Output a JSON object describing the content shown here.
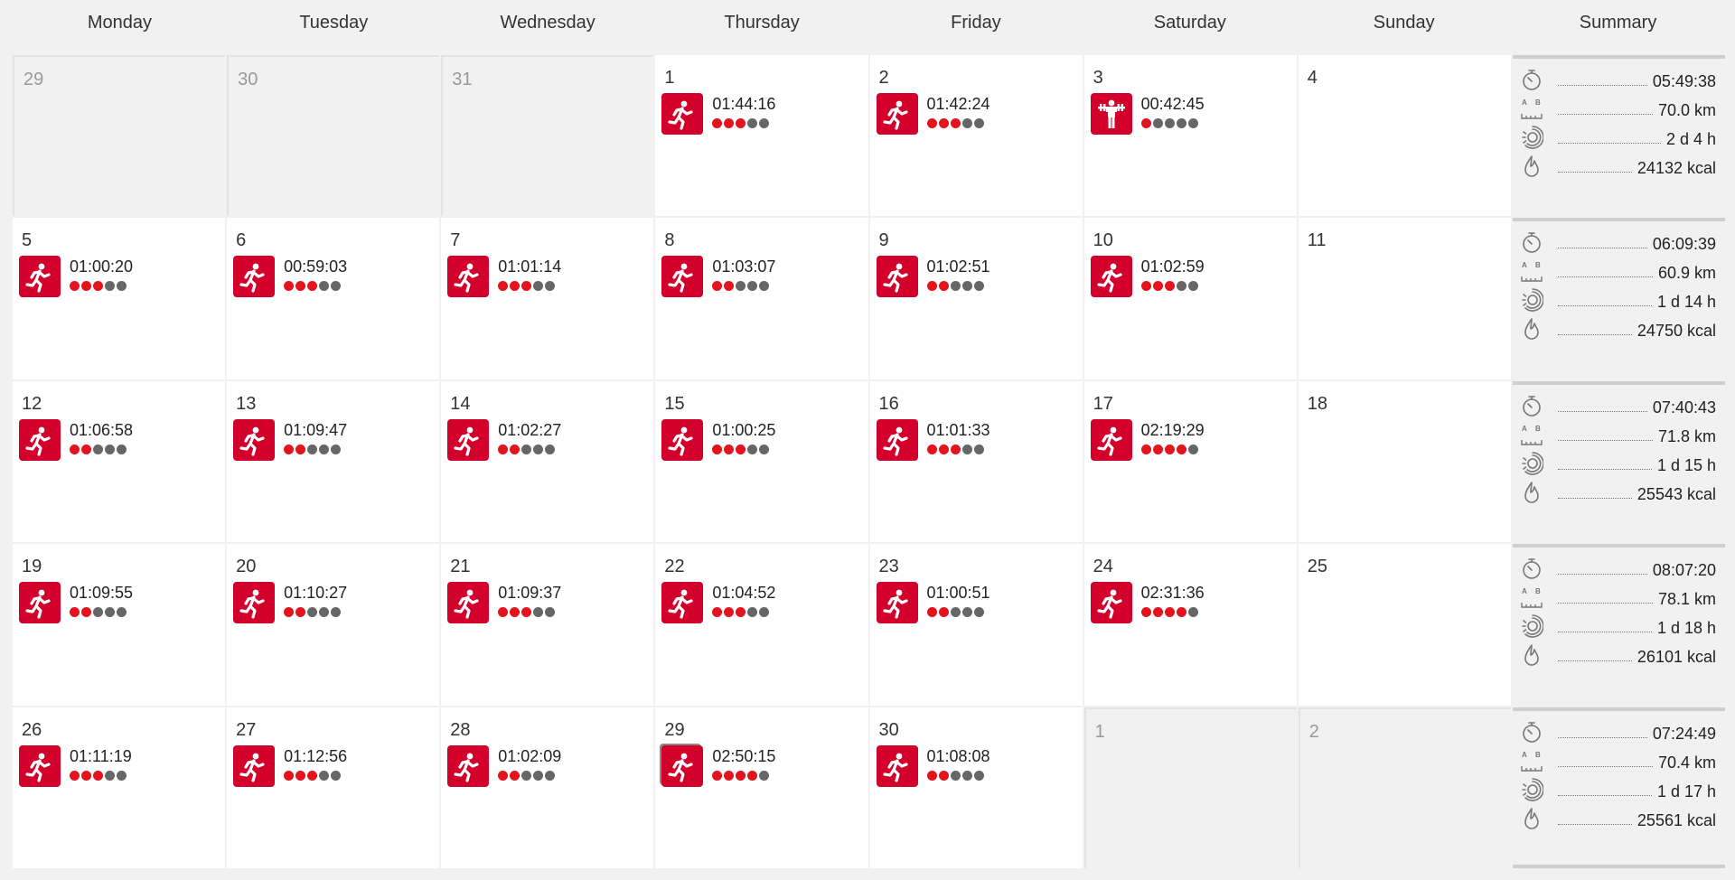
{
  "header": {
    "columns": [
      "Monday",
      "Tuesday",
      "Wednesday",
      "Thursday",
      "Friday",
      "Saturday",
      "Sunday",
      "Summary"
    ]
  },
  "colors": {
    "accent": "#d2002a",
    "dot_on": "#e3141e",
    "dot_off": "#666666"
  },
  "weeks": [
    {
      "days": [
        {
          "day": "29",
          "other_month": true
        },
        {
          "day": "30",
          "other_month": true
        },
        {
          "day": "31",
          "other_month": true
        },
        {
          "day": "1",
          "workout": {
            "sport": "running-icon",
            "duration": "01:44:16",
            "intensity": 3
          }
        },
        {
          "day": "2",
          "workout": {
            "sport": "running-icon",
            "duration": "01:42:24",
            "intensity": 3
          }
        },
        {
          "day": "3",
          "workout": {
            "sport": "strength-training-icon",
            "duration": "00:42:45",
            "intensity": 1
          }
        },
        {
          "day": "4"
        }
      ],
      "summary": {
        "duration": "05:49:38",
        "distance": "70.0 km",
        "recovery": "2 d 4 h",
        "calories": "24132 kcal"
      }
    },
    {
      "days": [
        {
          "day": "5",
          "workout": {
            "sport": "running-icon",
            "duration": "01:00:20",
            "intensity": 3
          }
        },
        {
          "day": "6",
          "workout": {
            "sport": "running-icon",
            "duration": "00:59:03",
            "intensity": 3
          }
        },
        {
          "day": "7",
          "workout": {
            "sport": "running-icon",
            "duration": "01:01:14",
            "intensity": 3
          }
        },
        {
          "day": "8",
          "workout": {
            "sport": "running-icon",
            "duration": "01:03:07",
            "intensity": 2
          }
        },
        {
          "day": "9",
          "workout": {
            "sport": "running-icon",
            "duration": "01:02:51",
            "intensity": 2
          }
        },
        {
          "day": "10",
          "workout": {
            "sport": "running-icon",
            "duration": "01:02:59",
            "intensity": 3
          }
        },
        {
          "day": "11"
        }
      ],
      "summary": {
        "duration": "06:09:39",
        "distance": "60.9 km",
        "recovery": "1 d 14 h",
        "calories": "24750 kcal"
      }
    },
    {
      "days": [
        {
          "day": "12",
          "workout": {
            "sport": "running-icon",
            "duration": "01:06:58",
            "intensity": 2
          }
        },
        {
          "day": "13",
          "workout": {
            "sport": "running-icon",
            "duration": "01:09:47",
            "intensity": 2
          }
        },
        {
          "day": "14",
          "workout": {
            "sport": "running-icon",
            "duration": "01:02:27",
            "intensity": 2
          }
        },
        {
          "day": "15",
          "workout": {
            "sport": "running-icon",
            "duration": "01:00:25",
            "intensity": 3
          }
        },
        {
          "day": "16",
          "workout": {
            "sport": "running-icon",
            "duration": "01:01:33",
            "intensity": 3
          }
        },
        {
          "day": "17",
          "workout": {
            "sport": "running-icon",
            "duration": "02:19:29",
            "intensity": 4
          }
        },
        {
          "day": "18"
        }
      ],
      "summary": {
        "duration": "07:40:43",
        "distance": "71.8 km",
        "recovery": "1 d 15 h",
        "calories": "25543 kcal"
      }
    },
    {
      "days": [
        {
          "day": "19",
          "workout": {
            "sport": "running-icon",
            "duration": "01:09:55",
            "intensity": 2
          }
        },
        {
          "day": "20",
          "workout": {
            "sport": "running-icon",
            "duration": "01:10:27",
            "intensity": 2
          }
        },
        {
          "day": "21",
          "workout": {
            "sport": "running-icon",
            "duration": "01:09:37",
            "intensity": 3
          }
        },
        {
          "day": "22",
          "workout": {
            "sport": "running-icon",
            "duration": "01:04:52",
            "intensity": 3
          }
        },
        {
          "day": "23",
          "workout": {
            "sport": "running-icon",
            "duration": "01:00:51",
            "intensity": 2
          }
        },
        {
          "day": "24",
          "workout": {
            "sport": "running-icon",
            "duration": "02:31:36",
            "intensity": 4
          }
        },
        {
          "day": "25"
        }
      ],
      "summary": {
        "duration": "08:07:20",
        "distance": "78.1 km",
        "recovery": "1 d 18 h",
        "calories": "26101 kcal"
      }
    },
    {
      "days": [
        {
          "day": "26",
          "workout": {
            "sport": "running-icon",
            "duration": "01:11:19",
            "intensity": 3
          }
        },
        {
          "day": "27",
          "workout": {
            "sport": "running-icon",
            "duration": "01:12:56",
            "intensity": 3
          }
        },
        {
          "day": "28",
          "workout": {
            "sport": "running-icon",
            "duration": "01:02:09",
            "intensity": 2
          }
        },
        {
          "day": "29",
          "workout": {
            "sport": "running-icon",
            "duration": "02:50:15",
            "intensity": 4,
            "selected": true
          }
        },
        {
          "day": "30",
          "workout": {
            "sport": "running-icon",
            "duration": "01:08:08",
            "intensity": 2
          }
        },
        {
          "day": "1",
          "other_month": true
        },
        {
          "day": "2",
          "other_month": true
        }
      ],
      "summary": {
        "duration": "07:24:49",
        "distance": "70.4 km",
        "recovery": "1 d 17 h",
        "calories": "25561 kcal"
      }
    }
  ],
  "summary_icons": [
    "stopwatch-icon",
    "distance-icon",
    "recovery-icon",
    "calories-icon"
  ]
}
